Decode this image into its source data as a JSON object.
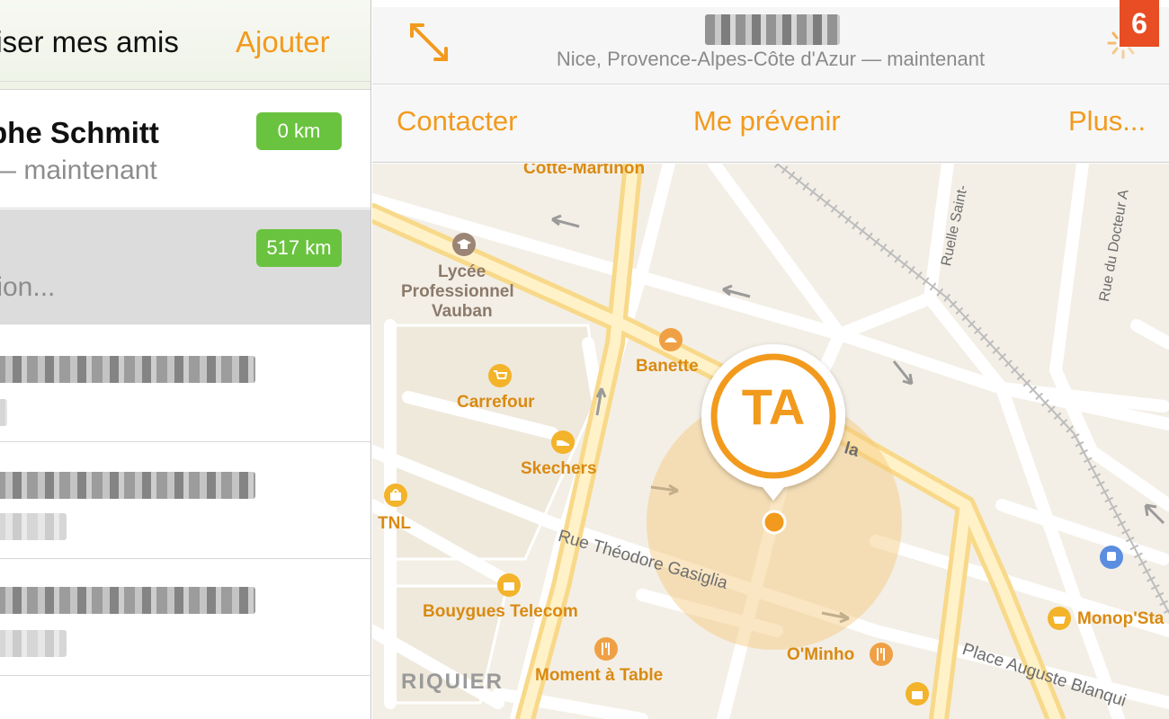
{
  "left_panel": {
    "title": "liser mes amis",
    "add_label": "Ajouter",
    "friends": [
      {
        "name": "phe Schmitt",
        "subtitle": "— maintenant",
        "distance": "0 km"
      },
      {
        "name": "",
        "subtitle": "tion...",
        "distance": "517 km"
      }
    ]
  },
  "top_bar": {
    "location": "Nice, Provence-Alpes-Côte d'Azur — maintenant"
  },
  "actions": {
    "contact": "Contacter",
    "notify": "Me prévenir",
    "more": "Plus..."
  },
  "map": {
    "marker_initials": "TA",
    "labels": {
      "cotte": "Cotte-Martinon",
      "lycee_1": "Lycée",
      "lycee_2": "Professionnel",
      "lycee_3": "Vauban",
      "banette": "Banette",
      "carrefour": "Carrefour",
      "skechers": "Skechers",
      "tnl": "TNL",
      "bouygues": "Bouygues Telecom",
      "moment": "Moment à Table",
      "ominho": "O'Minho",
      "monop": "Monop'Sta",
      "riquier": "RIQUIER",
      "gasiglia": "Rue Théodore Gasiglia",
      "blanqui": "Place Auguste Blanqui",
      "ruelle": "Ruelle Saint-",
      "docteur": "Rue du Docteur A",
      "la": "la"
    }
  },
  "badge": "6",
  "colors": {
    "accent": "#f29a1d",
    "distance_badge": "#6ac33f",
    "corner_badge": "#e84d24"
  }
}
